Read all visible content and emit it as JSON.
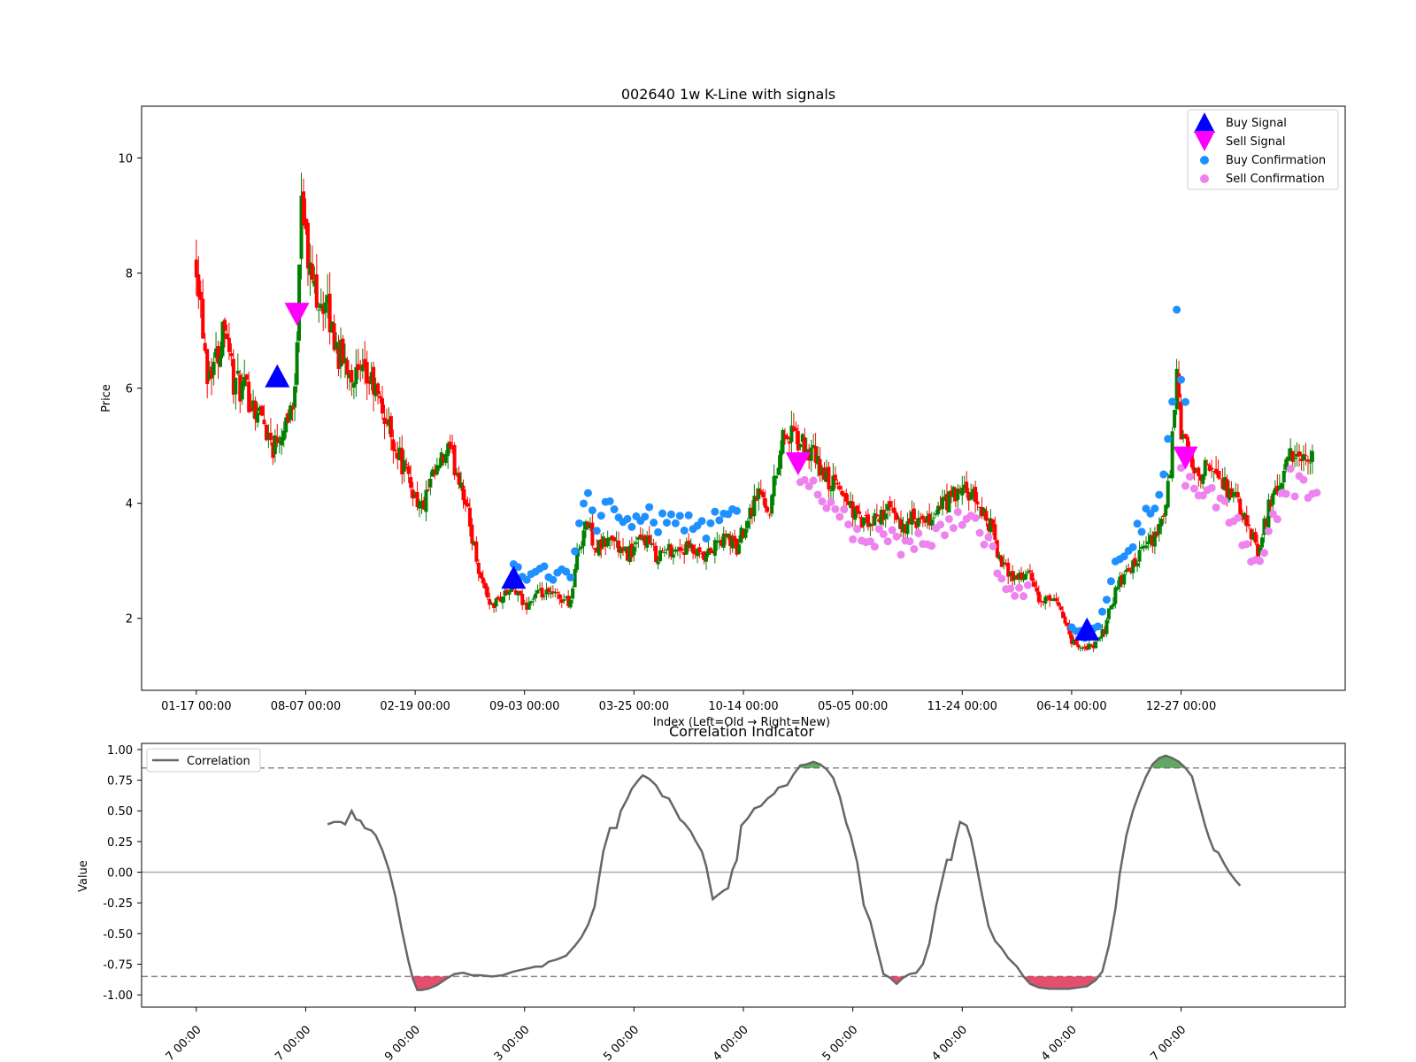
{
  "chart_data": [
    {
      "type": "candlestick",
      "title": "002640 1w K-Line with signals",
      "xlabel": "Index (Left=Old → Right=New)",
      "ylabel": "Price",
      "ylim": [
        0.75,
        10.9
      ],
      "xlim": [
        -10,
        540
      ],
      "y_ticks": [
        2,
        4,
        6,
        8,
        10
      ],
      "x_ticks": [
        {
          "pos": 15,
          "label": "01-17 00:00"
        },
        {
          "pos": 65,
          "label": "08-07 00:00"
        },
        {
          "pos": 115,
          "label": "02-19 00:00"
        },
        {
          "pos": 165,
          "label": "09-03 00:00"
        },
        {
          "pos": 215,
          "label": "03-25 00:00"
        },
        {
          "pos": 265,
          "label": "10-14 00:00"
        },
        {
          "pos": 315,
          "label": "05-05 00:00"
        },
        {
          "pos": 365,
          "label": "11-24 00:00"
        },
        {
          "pos": 415,
          "label": "06-14 00:00"
        },
        {
          "pos": 465,
          "label": "12-27 00:00"
        }
      ],
      "price_path": [
        [
          15,
          8.3
        ],
        [
          20,
          6.3
        ],
        [
          25,
          6.6
        ],
        [
          28,
          7.3
        ],
        [
          32,
          6.1
        ],
        [
          38,
          5.9
        ],
        [
          45,
          5.5
        ],
        [
          50,
          5.0
        ],
        [
          55,
          5.4
        ],
        [
          57,
          5.6
        ],
        [
          60,
          5.8
        ],
        [
          63,
          9.6
        ],
        [
          66,
          8.1
        ],
        [
          70,
          7.7
        ],
        [
          75,
          7.3
        ],
        [
          80,
          6.6
        ],
        [
          88,
          6.2
        ],
        [
          95,
          6.1
        ],
        [
          100,
          5.6
        ],
        [
          108,
          4.8
        ],
        [
          113,
          4.3
        ],
        [
          118,
          3.9
        ],
        [
          123,
          4.4
        ],
        [
          130,
          4.9
        ],
        [
          136,
          4.4
        ],
        [
          140,
          3.6
        ],
        [
          145,
          2.7
        ],
        [
          150,
          2.2
        ],
        [
          155,
          2.4
        ],
        [
          160,
          2.5
        ],
        [
          165,
          2.2
        ],
        [
          170,
          2.4
        ],
        [
          178,
          2.4
        ],
        [
          186,
          2.3
        ],
        [
          189,
          3.1
        ],
        [
          193,
          3.7
        ],
        [
          198,
          3.2
        ],
        [
          205,
          3.4
        ],
        [
          210,
          3.1
        ],
        [
          215,
          3.2
        ],
        [
          220,
          3.4
        ],
        [
          225,
          3.1
        ],
        [
          232,
          3.2
        ],
        [
          240,
          3.2
        ],
        [
          247,
          3.0
        ],
        [
          253,
          3.3
        ],
        [
          258,
          3.4
        ],
        [
          262,
          3.2
        ],
        [
          266,
          3.7
        ],
        [
          272,
          4.2
        ],
        [
          277,
          3.9
        ],
        [
          283,
          5.2
        ],
        [
          289,
          5.1
        ],
        [
          297,
          4.8
        ],
        [
          303,
          4.4
        ],
        [
          310,
          4.2
        ],
        [
          318,
          3.7
        ],
        [
          323,
          3.6
        ],
        [
          330,
          3.9
        ],
        [
          337,
          3.6
        ],
        [
          342,
          3.7
        ],
        [
          348,
          3.6
        ],
        [
          354,
          3.9
        ],
        [
          360,
          4.1
        ],
        [
          366,
          4.2
        ],
        [
          372,
          4.0
        ],
        [
          378,
          3.6
        ],
        [
          383,
          2.9
        ],
        [
          390,
          2.7
        ],
        [
          395,
          2.8
        ],
        [
          400,
          2.3
        ],
        [
          405,
          2.3
        ],
        [
          410,
          2.2
        ],
        [
          415,
          1.6
        ],
        [
          420,
          1.5
        ],
        [
          425,
          1.5
        ],
        [
          430,
          1.8
        ],
        [
          435,
          2.5
        ],
        [
          440,
          2.8
        ],
        [
          445,
          3.0
        ],
        [
          450,
          3.3
        ],
        [
          455,
          3.5
        ],
        [
          460,
          4.4
        ],
        [
          463,
          6.3
        ],
        [
          465,
          5.2
        ],
        [
          470,
          4.6
        ],
        [
          476,
          4.6
        ],
        [
          482,
          4.4
        ],
        [
          488,
          4.2
        ],
        [
          495,
          3.6
        ],
        [
          500,
          3.2
        ],
        [
          505,
          3.9
        ],
        [
          510,
          4.3
        ],
        [
          515,
          4.8
        ],
        [
          520,
          4.7
        ],
        [
          525,
          4.7
        ]
      ],
      "legend": [
        "Buy Signal",
        "Sell Signal",
        "Buy Confirmation",
        "Sell Confirmation"
      ],
      "legend_placement": "top-right",
      "buy_signals": [
        [
          52,
          6.2
        ],
        [
          160,
          2.7
        ],
        [
          422,
          1.8
        ]
      ],
      "sell_signals": [
        [
          61,
          7.3
        ],
        [
          290,
          4.7
        ],
        [
          467,
          4.8
        ]
      ],
      "buy_confirmation_ranges": [
        [
          160,
          263
        ],
        [
          415,
          468
        ]
      ],
      "sell_confirmation_ranges": [
        [
          289,
          395
        ],
        [
          465,
          528
        ]
      ],
      "colors": {
        "up": "#008000",
        "down": "#ff0000",
        "buy_signal": "#0000ff",
        "sell_signal": "#ff00ff",
        "buy_conf": "#1e90ff",
        "sell_conf": "#ee82ee"
      }
    },
    {
      "type": "line",
      "title": "Correlation Indicator",
      "ylabel": "Value",
      "ylim": [
        -1.1,
        1.05
      ],
      "y_ticks": [
        "1.00",
        "0.75",
        "0.50",
        "0.25",
        "0.00",
        "-0.25",
        "-0.50",
        "-0.75",
        "-1.00"
      ],
      "x_tick_labels": [
        "7 00:00",
        "7 00:00",
        "9 00:00",
        "3 00:00",
        "5 00:00",
        "4 00:00",
        "5 00:00",
        "4 00:00",
        "4 00:00",
        "7 00:00"
      ],
      "thresholds": [
        0.85,
        -0.85
      ],
      "legend": [
        "Correlation"
      ],
      "series": [
        {
          "name": "Correlation",
          "points": [
            [
              75,
              0.39
            ],
            [
              78,
              0.41
            ],
            [
              81,
              0.41
            ],
            [
              83,
              0.39
            ],
            [
              86,
              0.5
            ],
            [
              88,
              0.43
            ],
            [
              90,
              0.42
            ],
            [
              92,
              0.36
            ],
            [
              95,
              0.34
            ],
            [
              97,
              0.3
            ],
            [
              100,
              0.18
            ],
            [
              103,
              0.02
            ],
            [
              106,
              -0.2
            ],
            [
              109,
              -0.48
            ],
            [
              112,
              -0.73
            ],
            [
              114,
              -0.87
            ],
            [
              116,
              -0.96
            ],
            [
              118,
              -0.96
            ],
            [
              121,
              -0.95
            ],
            [
              125,
              -0.92
            ],
            [
              130,
              -0.86
            ],
            [
              133,
              -0.83
            ],
            [
              137,
              -0.82
            ],
            [
              141,
              -0.84
            ],
            [
              145,
              -0.84
            ],
            [
              150,
              -0.85
            ],
            [
              155,
              -0.84
            ],
            [
              160,
              -0.81
            ],
            [
              165,
              -0.79
            ],
            [
              170,
              -0.77
            ],
            [
              173,
              -0.77
            ],
            [
              176,
              -0.73
            ],
            [
              180,
              -0.71
            ],
            [
              184,
              -0.68
            ],
            [
              188,
              -0.6
            ],
            [
              191,
              -0.53
            ],
            [
              194,
              -0.43
            ],
            [
              197,
              -0.28
            ],
            [
              199,
              -0.05
            ],
            [
              201,
              0.17
            ],
            [
              204,
              0.36
            ],
            [
              207,
              0.36
            ],
            [
              209,
              0.5
            ],
            [
              212,
              0.6
            ],
            [
              214,
              0.68
            ],
            [
              217,
              0.75
            ],
            [
              219,
              0.79
            ],
            [
              222,
              0.76
            ],
            [
              225,
              0.71
            ],
            [
              228,
              0.62
            ],
            [
              231,
              0.6
            ],
            [
              234,
              0.5
            ],
            [
              236,
              0.43
            ],
            [
              238,
              0.4
            ],
            [
              241,
              0.33
            ],
            [
              243,
              0.26
            ],
            [
              246,
              0.17
            ],
            [
              248,
              0.05
            ],
            [
              251,
              -0.22
            ],
            [
              253,
              -0.19
            ],
            [
              256,
              -0.15
            ],
            [
              258,
              -0.13
            ],
            [
              260,
              0.02
            ],
            [
              262,
              0.1
            ],
            [
              264,
              0.38
            ],
            [
              267,
              0.44
            ],
            [
              270,
              0.52
            ],
            [
              273,
              0.54
            ],
            [
              276,
              0.6
            ],
            [
              279,
              0.64
            ],
            [
              281,
              0.69
            ],
            [
              285,
              0.71
            ],
            [
              288,
              0.8
            ],
            [
              291,
              0.87
            ],
            [
              294,
              0.88
            ],
            [
              297,
              0.9
            ],
            [
              300,
              0.88
            ],
            [
              303,
              0.84
            ],
            [
              306,
              0.77
            ],
            [
              309,
              0.62
            ],
            [
              312,
              0.4
            ],
            [
              314,
              0.3
            ],
            [
              317,
              0.08
            ],
            [
              320,
              -0.27
            ],
            [
              323,
              -0.4
            ],
            [
              326,
              -0.62
            ],
            [
              329,
              -0.83
            ],
            [
              332,
              -0.86
            ],
            [
              335,
              -0.91
            ],
            [
              338,
              -0.86
            ],
            [
              341,
              -0.83
            ],
            [
              344,
              -0.82
            ],
            [
              347,
              -0.75
            ],
            [
              350,
              -0.58
            ],
            [
              353,
              -0.28
            ],
            [
              356,
              -0.05
            ],
            [
              358,
              0.1
            ],
            [
              360,
              0.1
            ],
            [
              362,
              0.27
            ],
            [
              364,
              0.41
            ],
            [
              367,
              0.38
            ],
            [
              369,
              0.27
            ],
            [
              371,
              0.1
            ],
            [
              374,
              -0.18
            ],
            [
              377,
              -0.44
            ],
            [
              380,
              -0.56
            ],
            [
              383,
              -0.62
            ],
            [
              386,
              -0.7
            ],
            [
              390,
              -0.77
            ],
            [
              393,
              -0.85
            ],
            [
              396,
              -0.91
            ],
            [
              400,
              -0.94
            ],
            [
              405,
              -0.95
            ],
            [
              410,
              -0.95
            ],
            [
              414,
              -0.95
            ],
            [
              418,
              -0.94
            ],
            [
              422,
              -0.93
            ],
            [
              426,
              -0.88
            ],
            [
              429,
              -0.81
            ],
            [
              432,
              -0.6
            ],
            [
              435,
              -0.3
            ],
            [
              437,
              -0.01
            ],
            [
              440,
              0.3
            ],
            [
              443,
              0.5
            ],
            [
              446,
              0.65
            ],
            [
              449,
              0.78
            ],
            [
              452,
              0.88
            ],
            [
              455,
              0.93
            ],
            [
              458,
              0.95
            ],
            [
              461,
              0.93
            ],
            [
              464,
              0.9
            ],
            [
              467,
              0.85
            ],
            [
              470,
              0.78
            ],
            [
              473,
              0.58
            ],
            [
              476,
              0.38
            ],
            [
              478,
              0.27
            ],
            [
              480,
              0.18
            ],
            [
              482,
              0.16
            ],
            [
              485,
              0.06
            ],
            [
              487,
              0.0
            ],
            [
              490,
              -0.07
            ],
            [
              492,
              -0.11
            ]
          ]
        }
      ],
      "colors": {
        "line": "#666666",
        "positive_fill": "#2e8b2e",
        "negative_fill": "#dc143c"
      }
    }
  ]
}
